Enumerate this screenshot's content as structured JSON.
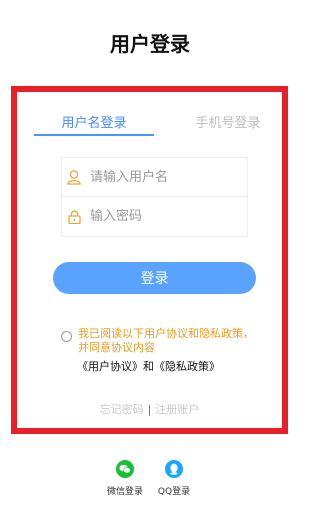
{
  "page": {
    "title": "用户登录"
  },
  "tabs": [
    {
      "label": "用户名登录",
      "active": true
    },
    {
      "label": "手机号登录",
      "active": false
    }
  ],
  "form": {
    "username_placeholder": "请输入用户名",
    "password_placeholder": "输入密码",
    "username_value": "",
    "password_value": "",
    "user_icon": "user-icon",
    "lock_icon": "lock-icon"
  },
  "login_button": {
    "label": "登录"
  },
  "agreement": {
    "checked": false,
    "text": "我已阅读以下用户协议和隐私政策，并同意协议内容",
    "user_agreement": "《用户协议》",
    "and": "和",
    "privacy_policy": "《隐私政策》"
  },
  "footer_links": {
    "forgot_password": "忘记密码",
    "separator": "|",
    "register": "注册账户"
  },
  "third_party": [
    {
      "label": "微信登录",
      "icon": "wechat-icon"
    },
    {
      "label": "QQ登录",
      "icon": "qq-icon"
    }
  ],
  "colors": {
    "frame": "#e8202a",
    "accent": "#3f8cff",
    "button": "#59a3ff",
    "agreement_text": "#ef9a1f",
    "wechat": "#18c035",
    "qq": "#17a7ff"
  }
}
